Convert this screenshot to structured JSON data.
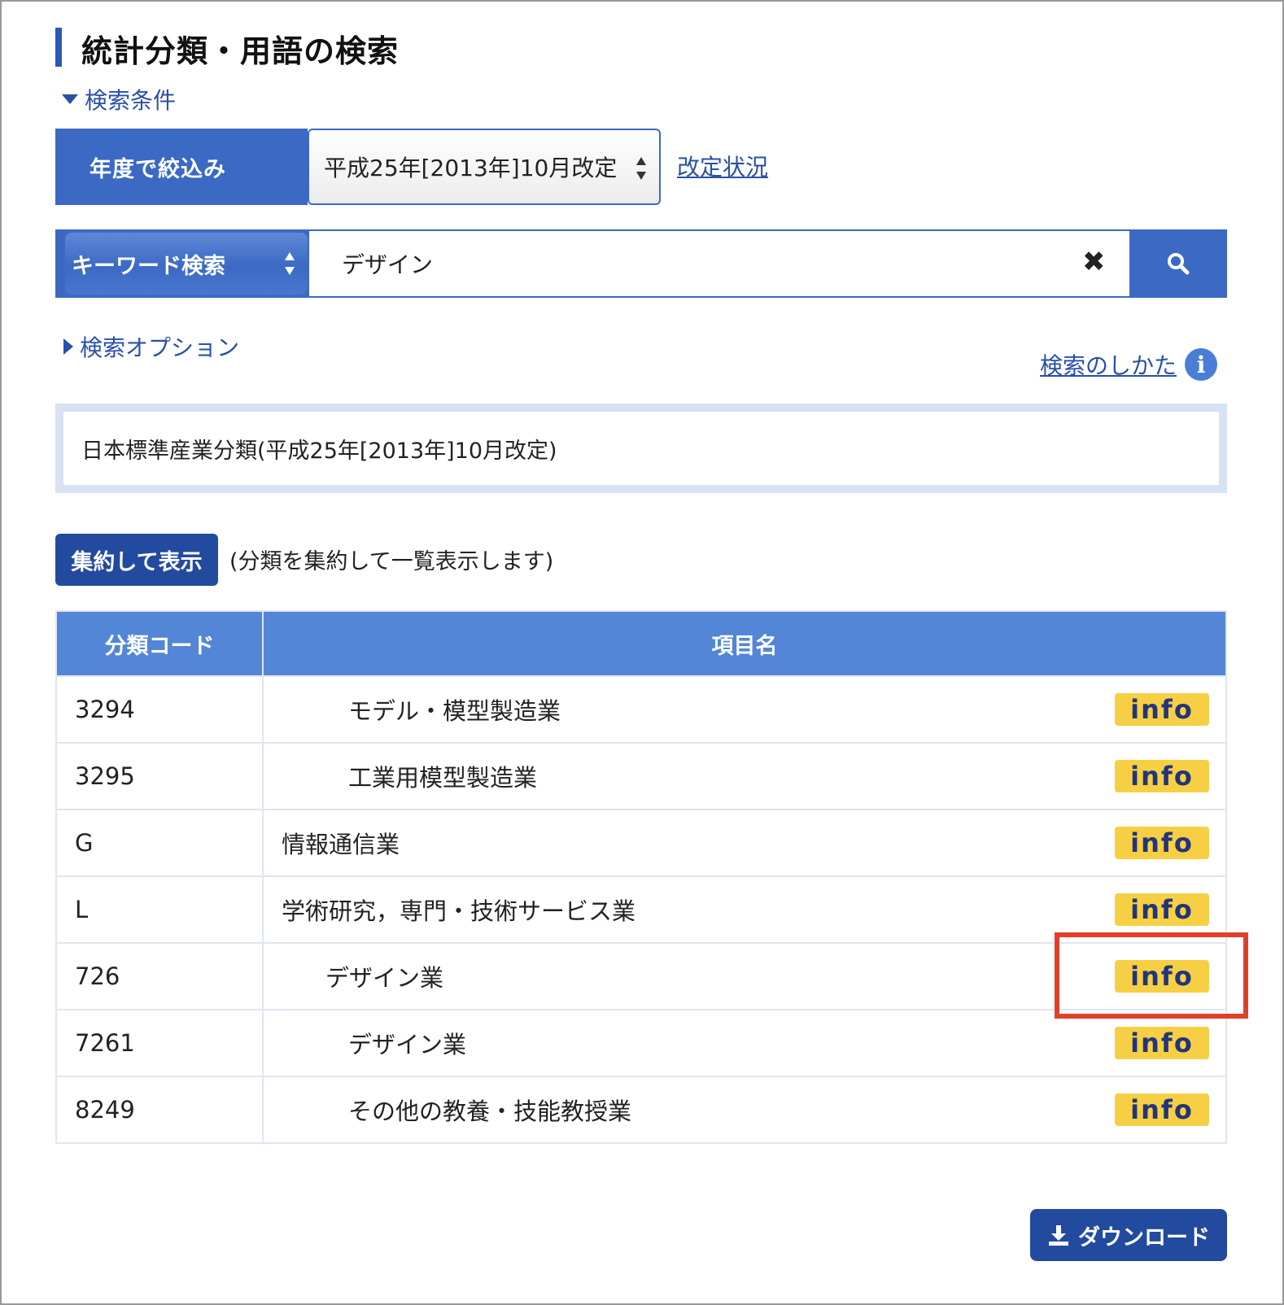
{
  "header": {
    "title": "統計分類・用語の検索"
  },
  "search_conditions": {
    "label": "検索条件"
  },
  "year_filter": {
    "label": "年度で絞込み",
    "selected": "平成25年[2013年]10月改定",
    "status_link": "改定状況"
  },
  "keyword_search": {
    "mode": "キーワード検索",
    "value": "デザイン"
  },
  "search_options": {
    "label": "検索オプション"
  },
  "help": {
    "label": "検索のしかた"
  },
  "classification": {
    "name": "日本標準産業分類(平成25年[2013年]10月改定)"
  },
  "aggregate": {
    "button_label": "集約して表示",
    "note": "(分類を集約して一覧表示します)"
  },
  "table": {
    "headers": [
      "分類コード",
      "項目名"
    ],
    "info_label": "info",
    "rows": [
      {
        "code": "3294",
        "name": "モデル・模型製造業",
        "level": 3
      },
      {
        "code": "3295",
        "name": "工業用模型製造業",
        "level": 3
      },
      {
        "code": "G",
        "name": "情報通信業",
        "level": 0
      },
      {
        "code": "L",
        "name": "学術研究，専門・技術サービス業",
        "level": 0
      },
      {
        "code": "726",
        "name": "デザイン業",
        "level": 2
      },
      {
        "code": "7261",
        "name": "デザイン業",
        "level": 3
      },
      {
        "code": "8249",
        "name": "その他の教養・技能教授業",
        "level": 3
      }
    ]
  },
  "download": {
    "label": "ダウンロード"
  },
  "colors": {
    "primary": "#3b69c4",
    "dark_primary": "#224a9e",
    "table_header": "#5386d6",
    "info_badge": "#f6cf44",
    "highlight": "#e0402a",
    "link": "#2a50a8"
  }
}
